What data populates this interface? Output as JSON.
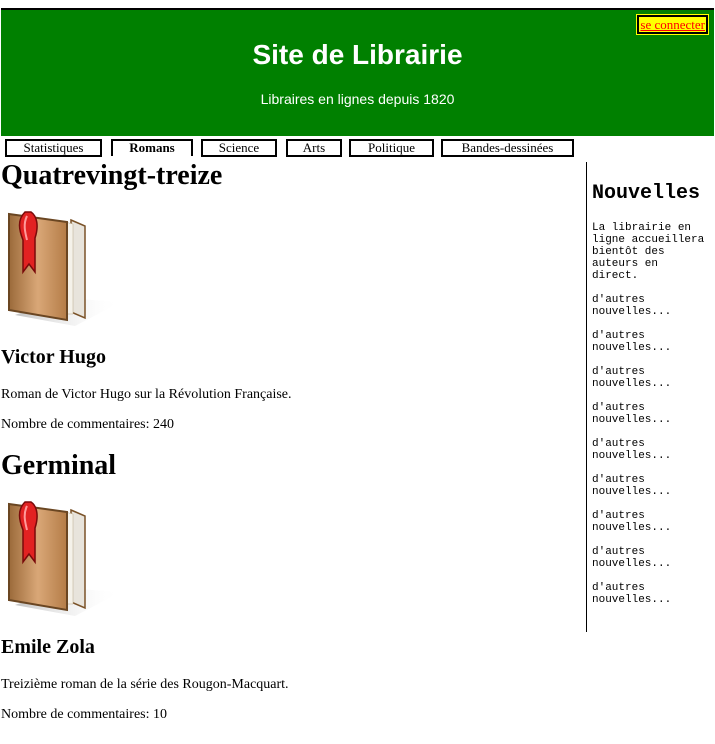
{
  "header": {
    "title": "Site de Librairie",
    "subtitle": "Libraires en lignes depuis 1820",
    "login_label": "se connecter",
    "background_color": "#008000",
    "login_bg_color": "#ffff00",
    "login_text_color": "#ff0000"
  },
  "nav": {
    "tabs": [
      {
        "label": "Statistiques",
        "active": false
      },
      {
        "label": "Romans",
        "active": true
      },
      {
        "label": "Science",
        "active": false
      },
      {
        "label": "Arts",
        "active": false
      },
      {
        "label": "Politique",
        "active": false
      },
      {
        "label": "Bandes-dessinées",
        "active": false
      }
    ]
  },
  "books": [
    {
      "title": "Quatrevingt-treize",
      "icon": "book-icon",
      "author": "Victor Hugo",
      "description": "Roman de Victor Hugo sur la Révolution Française.",
      "comments": "Nombre de commentaires: 240"
    },
    {
      "title": "Germinal",
      "icon": "book-icon",
      "author": "Emile Zola",
      "description": "Treizième roman de la série des Rougon-Macquart.",
      "comments": "Nombre de commentaires: 10"
    }
  ],
  "sidebar": {
    "title": "Nouvelles",
    "news": [
      "La librairie en ligne accueillera bientôt des auteurs en direct.",
      "d'autres nouvelles...",
      "d'autres nouvelles...",
      "d'autres nouvelles...",
      "d'autres nouvelles...",
      "d'autres nouvelles...",
      "d'autres nouvelles...",
      "d'autres nouvelles...",
      "d'autres nouvelles...",
      "d'autres nouvelles..."
    ]
  }
}
